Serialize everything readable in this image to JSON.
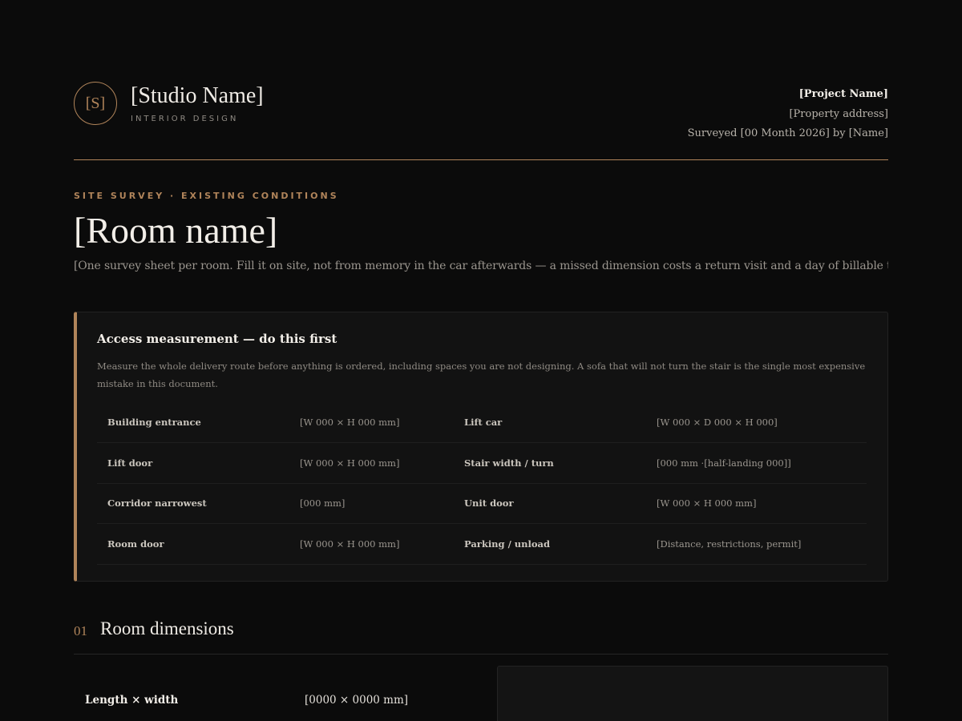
{
  "header": {
    "logo_initials": "[S]",
    "studio_name": "[Studio Name]",
    "studio_tagline": "INTERIOR DESIGN",
    "project_name": "[Project Name]",
    "property_address": "[Property address]",
    "surveyed_line": "Surveyed [00 Month 2026] by [Name]"
  },
  "title_area": {
    "eyebrow": "SITE SURVEY · EXISTING CONDITIONS",
    "room_name": "[Room name]",
    "intro": "[One survey sheet per room. Fill it on site, not from memory in the car afterwards — a missed dimension costs a return visit and a day of billable time.]"
  },
  "access": {
    "title": "Access measurement — do this first",
    "description": "Measure the whole delivery route before anything is ordered, including spaces you are not designing. A sofa that will not turn the stair is the single most expensive mistake in this document.",
    "rows": [
      {
        "label_a": "Building entrance",
        "value_a": "[W 000 × H 000 mm]",
        "label_b": "Lift car",
        "value_b": "[W 000 × D 000 × H 000]"
      },
      {
        "label_a": "Lift door",
        "value_a": "[W 000 × H 000 mm]",
        "label_b": "Stair width / turn",
        "value_b": "[000 mm ·[half-landing 000]]"
      },
      {
        "label_a": "Corridor narrowest",
        "value_a": "[000 mm]",
        "label_b": "Unit door",
        "value_b": "[W 000 × H 000 mm]"
      },
      {
        "label_a": "Room door",
        "value_a": "[W 000 × H 000 mm]",
        "label_b": "Parking / unload",
        "value_b": "[Distance, restrictions, permit]"
      }
    ]
  },
  "section_01": {
    "number": "01",
    "title": "Room dimensions",
    "rows": [
      {
        "label": "Length × width",
        "value": "[0000 × 0000 mm]"
      }
    ]
  },
  "colors": {
    "background": "#0b0b0b",
    "accent": "#b0845a",
    "card": "#121212"
  }
}
